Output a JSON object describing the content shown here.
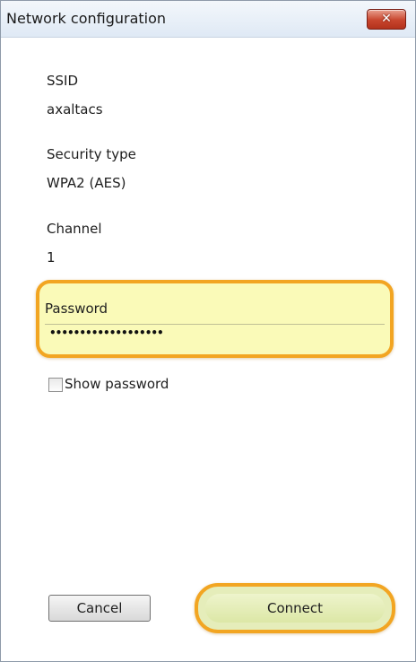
{
  "window": {
    "title": "Network configuration",
    "close_glyph": "✕",
    "close_color": "#c8452d"
  },
  "fields": {
    "ssid": {
      "label": "SSID",
      "value": "axaltacs"
    },
    "security": {
      "label": "Security type",
      "value": "WPA2 (AES)"
    },
    "channel": {
      "label": "Channel",
      "value": "1"
    }
  },
  "password": {
    "label": "Password",
    "value": "•••••••••••••••••••",
    "highlight_color": "#f2a522",
    "field_bg": "#fafab8"
  },
  "show_password": {
    "label": "Show password",
    "checked": false
  },
  "buttons": {
    "cancel_label": "Cancel",
    "connect_label": "Connect"
  }
}
